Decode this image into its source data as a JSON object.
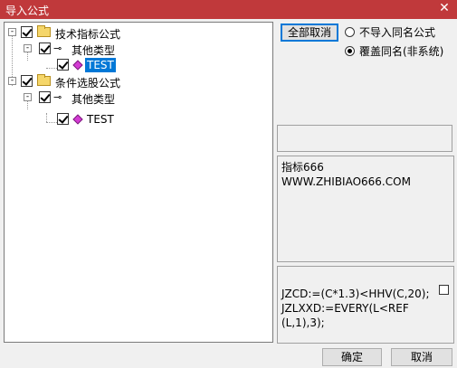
{
  "window": {
    "title": "导入公式",
    "close_glyph": "✕"
  },
  "tree": {
    "nodes": [
      {
        "label": "技术指标公式",
        "expander": "-"
      },
      {
        "label": "其他类型",
        "expander": "-"
      },
      {
        "label": "TEST"
      },
      {
        "label": "条件选股公式",
        "expander": "-"
      },
      {
        "label": "其他类型",
        "expander": "-"
      },
      {
        "label": "TEST"
      }
    ]
  },
  "actions": {
    "cancel_all_label": "全部取消",
    "options": [
      {
        "label": "不导入同名公式",
        "selected": false
      },
      {
        "label": "覆盖同名(非系统)",
        "selected": true
      }
    ]
  },
  "info": {
    "line1": "指标666",
    "line2": "WWW.ZHIBIAO666.COM"
  },
  "code": {
    "line1": "JZCD:=(C*1.3)<HHV(C,20);",
    "line2": "JZLXXD:=EVERY(L<REF",
    "line3": "(L,1),3);"
  },
  "footer": {
    "ok_label": "确定",
    "cancel_label": "取消"
  },
  "colors": {
    "titlebar": "#c0393b",
    "selection": "#0078d7"
  }
}
